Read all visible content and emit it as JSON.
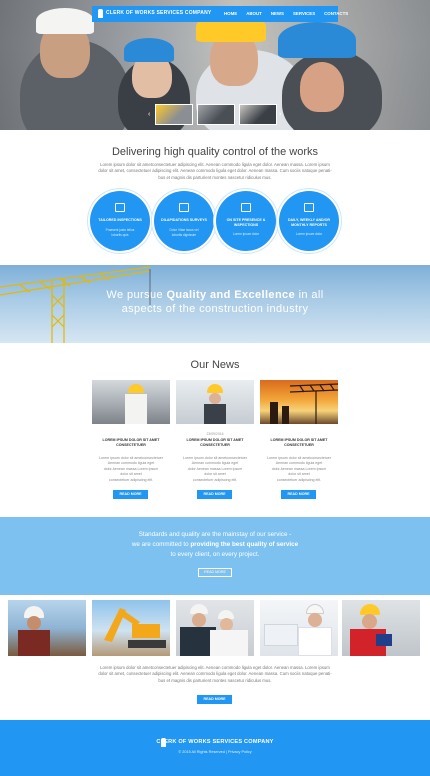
{
  "nav": {
    "brand": "CLERK OF WORKS SERVICES COMPANY",
    "links": [
      "HOME",
      "ABOUT",
      "NEWS",
      "SERVICES",
      "CONTACTS"
    ]
  },
  "intro": {
    "title": "Delivering high quality control of the works",
    "lines": [
      "Lorem ipsum dolor sit ametconsectetuer adipiscing elit. Aenean commodo ligula eget dolor. Aenean massa. Lorem ipsum",
      "dolor sit amet, consectetuer adipiscing elit. Aenean commodo ligula eget dolor. Aenean massa. Cum sociis natoque penati-",
      "bus et magnis dis parturient montes nascetur ridiculus mus."
    ]
  },
  "features": [
    {
      "icon": "clipboard-icon",
      "title": "TAILORED INSPECTIONS",
      "sub": [
        "Praesent justo tellus",
        "lobortis quis"
      ]
    },
    {
      "icon": "document-icon",
      "title": "DILAPIDATIONS SURVEYS",
      "sub": [
        "Dolor Vitae lacus vel",
        "lobortis dignissim"
      ]
    },
    {
      "icon": "binoculars-icon",
      "title": "ON SITE PRESENCE & INSPECTIONS",
      "sub": [
        "Lorem ipsum dolor"
      ]
    },
    {
      "icon": "calendar-icon",
      "title": "DAILY, WEEKLY AND/OR MONTHLY REPORTS",
      "sub": [
        "Lorem ipsum dolor"
      ]
    }
  ],
  "quality": {
    "line1_pre": "We pursue ",
    "line1_bold": "Quality and Excellence",
    "line1_post": " in all",
    "line2": "aspects of the construction industry"
  },
  "news": {
    "title": "Our News",
    "items": [
      {
        "date": "",
        "heading": "LOREM IPSUM DOLOR SIT AMET CONSECTETUER",
        "body": [
          "Lorem ipsum dolor sit ametconsectetuer",
          "Aenean commodo ligula eget",
          "dolor Aenean massa Lorem ipsum",
          "dolor sit amet",
          "consectetuer adipiscing elit."
        ],
        "button": "READ MORE"
      },
      {
        "date": "23/09/2016",
        "heading": "LOREM IPSUM DOLOR SIT AMET CONSECTETUER",
        "body": [
          "Lorem ipsum dolor sit ametconsectetuer",
          "Aenean commodo ligula eget",
          "dolor Aenean massa Lorem ipsum",
          "dolor sit amet",
          "consectetuer adipiscing elit."
        ],
        "button": "READ MORE"
      },
      {
        "date": "",
        "heading": "LOREM IPSUM DOLOR SIT AMET CONSECTETUER",
        "body": [
          "Lorem ipsum dolor sit ametconsectetuer",
          "Aenean commodo ligula eget",
          "dolor Aenean massa Lorem ipsum",
          "dolor sit amet",
          "consectetuer adipiscing elit."
        ],
        "button": "READ MORE"
      }
    ]
  },
  "standards": {
    "line1": "Standards and quality are the mainstay of our service -",
    "line2_pre": "we are committed to ",
    "line2_bold": "providing the best quality of service",
    "line3": "to every client, on every project.",
    "button": "READ MORE"
  },
  "gallery": {
    "lines": [
      "Lorem ipsum dolor sit ametconsectetuer adipiscing elit. Aenean commodo ligula eget dolor. Aenean massa. Lorem ipsum",
      "dolor sit amet, consectetuer adipiscing elit. Aenean commodo ligula eget dolor. Aenean massa. Cum sociis natoque penati-",
      "bus et magnis dis parturient montes nascetur ridiculus mus."
    ],
    "button": "READ MORE"
  },
  "footer": {
    "brand": "CLERK OF WORKS SERVICES COMPANY",
    "copyright": "© 2015 All Rights Reserved  |  Privacy Policy"
  },
  "colors": {
    "accent": "#2196f3",
    "light_accent": "#7cc1f0"
  }
}
